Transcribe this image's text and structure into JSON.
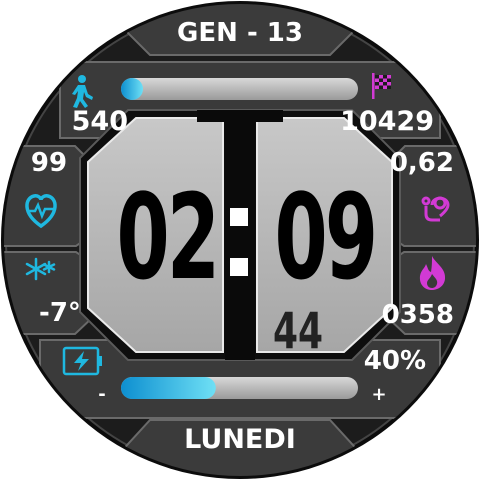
{
  "header": {
    "title": "GEN - 13"
  },
  "steps": {
    "current": "540",
    "goal": "10429",
    "progress": 0.07
  },
  "heart_rate": {
    "value": "99"
  },
  "distance": {
    "value": "0,62"
  },
  "weather": {
    "temperature": "-7°"
  },
  "calories": {
    "value": "0358"
  },
  "time": {
    "hours": "02",
    "minutes": "09",
    "seconds": "44"
  },
  "battery": {
    "percent": "40%",
    "level": 0.4,
    "minus_label": "-",
    "plus_label": "+"
  },
  "footer": {
    "day": "LUNEDI"
  },
  "colors": {
    "accent_cyan": "#1fb8e0",
    "accent_magenta": "#d23ad4",
    "panel": "#3a3a3a",
    "dial_bezel": "#111111"
  },
  "icons": [
    "walking-person-icon",
    "checkered-flag-icon",
    "heart-pulse-icon",
    "route-pin-icon",
    "snowflake-icon",
    "flame-icon",
    "battery-charging-icon"
  ]
}
